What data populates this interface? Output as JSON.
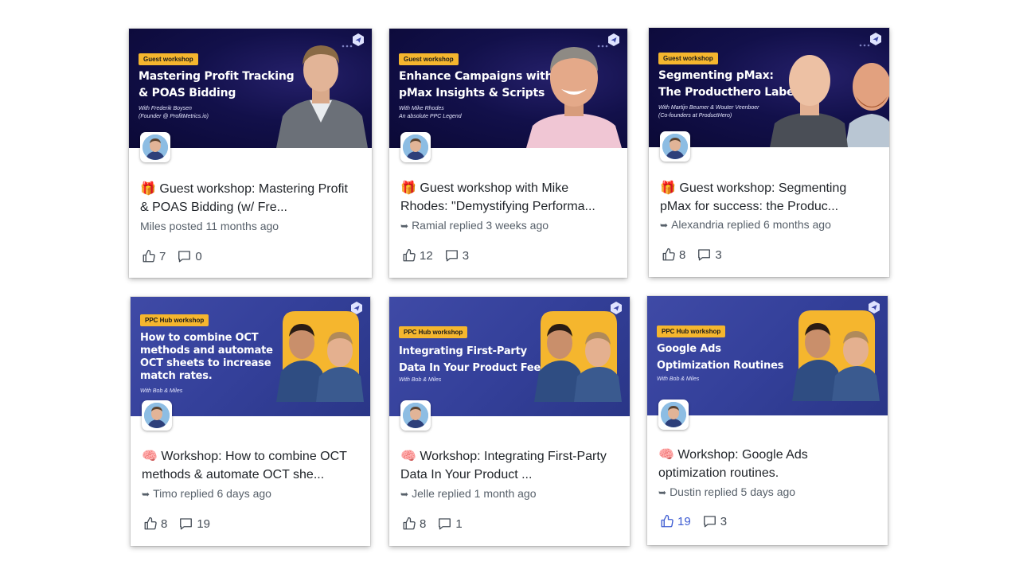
{
  "cards": [
    {
      "tag": "Guest workshop",
      "banner_title": "Mastering Profit Tracking\n& POAS Bidding",
      "banner_sub": "With Frederik Boysen\n(Founder @ ProfitMetrics.io)",
      "title": "🎁 Guest workshop: Mastering Profit\n& POAS Bidding (w/ Fre...",
      "meta": "Miles posted 11 months ago",
      "likes": "7",
      "comments": "0",
      "liked": false
    },
    {
      "tag": "Guest workshop",
      "banner_title": "Enhance Campaigns with\npMax Insights & Scripts",
      "banner_sub": "With Mike Rhodes\nAn absolute PPC Legend",
      "title": "🎁 Guest workshop with Mike\nRhodes: \"Demystifying Performa...",
      "meta": "Ramial replied 3 weeks ago",
      "likes": "12",
      "comments": "3",
      "liked": false
    },
    {
      "tag": "Guest workshop",
      "banner_title": "Segmenting pMax:\nThe Producthero Labelizer",
      "banner_sub": "With Martijn Beumer & Wouter Veenboer\n(Co-founders at ProductHero)",
      "title": "🎁 Guest workshop: Segmenting\npMax for success: the Produc...",
      "meta": "Alexandria replied 6 months ago",
      "likes": "8",
      "comments": "3",
      "liked": false
    },
    {
      "tag": "PPC Hub workshop",
      "banner_title": "How to combine OCT\nmethods and automate\nOCT sheets to increase\nmatch rates.",
      "banner_sub": "With Bob & Miles",
      "title": "🧠 Workshop: How to combine OCT\nmethods & automate OCT she...",
      "meta": "Timo replied 6 days ago",
      "likes": "8",
      "comments": "19",
      "liked": false
    },
    {
      "tag": "PPC Hub workshop",
      "banner_title": "Integrating First-Party\nData In Your Product Feed",
      "banner_sub": "With Bob & Miles",
      "title": "🧠 Workshop: Integrating First-Party\nData In Your Product ...",
      "meta": "Jelle replied 1 month ago",
      "likes": "8",
      "comments": "1",
      "liked": false
    },
    {
      "tag": "PPC Hub workshop",
      "banner_title": "Google Ads\nOptimization Routines",
      "banner_sub": "With Bob & Miles",
      "title": "🧠 Workshop: Google Ads\noptimization routines.",
      "meta": "Dustin replied 5 days ago",
      "likes": "19",
      "comments": "3",
      "liked": true
    }
  ],
  "colors": {
    "accent": "#3c5bd2",
    "tag": "#f5b62e",
    "banner_dark": "#12104a",
    "banner_blue": "#34409a"
  }
}
